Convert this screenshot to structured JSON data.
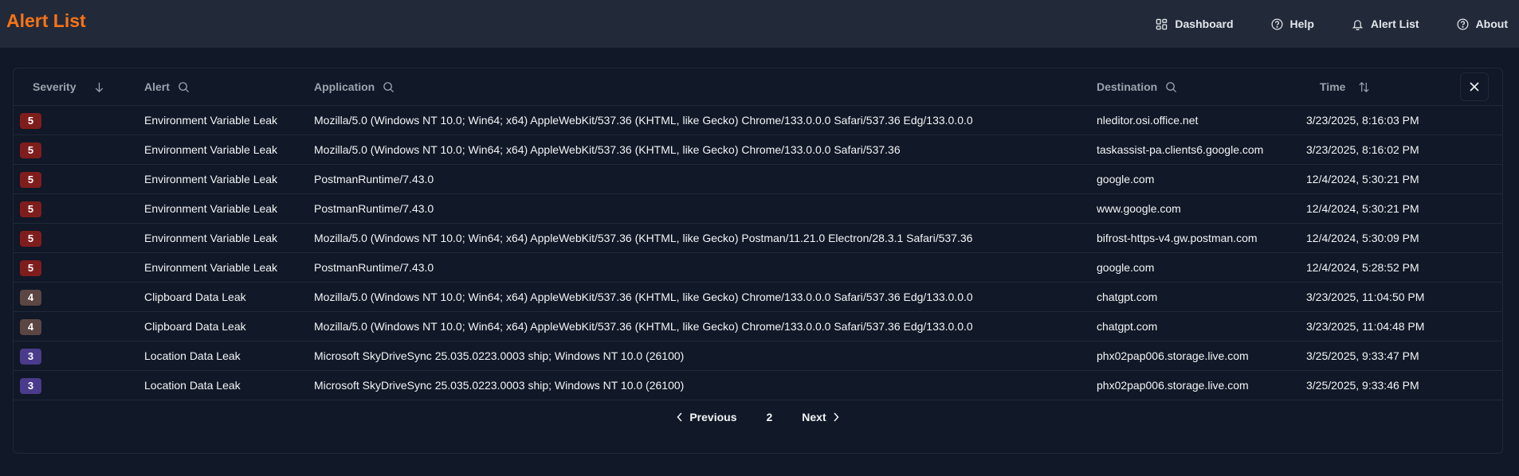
{
  "app": {
    "title": "Alert List"
  },
  "nav": [
    {
      "label": "Dashboard",
      "icon": "grid-icon"
    },
    {
      "label": "Help",
      "icon": "help-circle-icon"
    },
    {
      "label": "Alert List",
      "icon": "bell-icon"
    },
    {
      "label": "About",
      "icon": "help-circle-icon"
    }
  ],
  "table": {
    "headers": {
      "severity": "Severity",
      "alert": "Alert",
      "application": "Application",
      "destination": "Destination",
      "time": "Time"
    },
    "severity_colors": {
      "5": "#7f1d1d",
      "4": "#5b4644",
      "3": "#4a3b8c"
    },
    "rows": [
      {
        "severity": "5",
        "alert": "Environment Variable Leak",
        "application": "Mozilla/5.0 (Windows NT 10.0; Win64; x64) AppleWebKit/537.36 (KHTML, like Gecko) Chrome/133.0.0.0 Safari/537.36 Edg/133.0.0.0",
        "destination": "nleditor.osi.office.net",
        "time": "3/23/2025, 8:16:03 PM"
      },
      {
        "severity": "5",
        "alert": "Environment Variable Leak",
        "application": "Mozilla/5.0 (Windows NT 10.0; Win64; x64) AppleWebKit/537.36 (KHTML, like Gecko) Chrome/133.0.0.0 Safari/537.36",
        "destination": "taskassist-pa.clients6.google.com",
        "time": "3/23/2025, 8:16:02 PM"
      },
      {
        "severity": "5",
        "alert": "Environment Variable Leak",
        "application": "PostmanRuntime/7.43.0",
        "destination": "google.com",
        "time": "12/4/2024, 5:30:21 PM"
      },
      {
        "severity": "5",
        "alert": "Environment Variable Leak",
        "application": "PostmanRuntime/7.43.0",
        "destination": "www.google.com",
        "time": "12/4/2024, 5:30:21 PM"
      },
      {
        "severity": "5",
        "alert": "Environment Variable Leak",
        "application": "Mozilla/5.0 (Windows NT 10.0; Win64; x64) AppleWebKit/537.36 (KHTML, like Gecko) Postman/11.21.0 Electron/28.3.1 Safari/537.36",
        "destination": "bifrost-https-v4.gw.postman.com",
        "time": "12/4/2024, 5:30:09 PM"
      },
      {
        "severity": "5",
        "alert": "Environment Variable Leak",
        "application": "PostmanRuntime/7.43.0",
        "destination": "google.com",
        "time": "12/4/2024, 5:28:52 PM"
      },
      {
        "severity": "4",
        "alert": "Clipboard Data Leak",
        "application": "Mozilla/5.0 (Windows NT 10.0; Win64; x64) AppleWebKit/537.36 (KHTML, like Gecko) Chrome/133.0.0.0 Safari/537.36 Edg/133.0.0.0",
        "destination": "chatgpt.com",
        "time": "3/23/2025, 11:04:50 PM"
      },
      {
        "severity": "4",
        "alert": "Clipboard Data Leak",
        "application": "Mozilla/5.0 (Windows NT 10.0; Win64; x64) AppleWebKit/537.36 (KHTML, like Gecko) Chrome/133.0.0.0 Safari/537.36 Edg/133.0.0.0",
        "destination": "chatgpt.com",
        "time": "3/23/2025, 11:04:48 PM"
      },
      {
        "severity": "3",
        "alert": "Location Data Leak",
        "application": "Microsoft SkyDriveSync 25.035.0223.0003 ship; Windows NT 10.0 (26100)",
        "destination": "phx02pap006.storage.live.com",
        "time": "3/25/2025, 9:33:47 PM"
      },
      {
        "severity": "3",
        "alert": "Location Data Leak",
        "application": "Microsoft SkyDriveSync 25.035.0223.0003 ship; Windows NT 10.0 (26100)",
        "destination": "phx02pap006.storage.live.com",
        "time": "3/25/2025, 9:33:46 PM"
      }
    ]
  },
  "pagination": {
    "previous": "Previous",
    "current": "2",
    "next": "Next"
  },
  "colors": {
    "accent": "#f97316",
    "background": "#111827",
    "header": "#222a3a"
  }
}
